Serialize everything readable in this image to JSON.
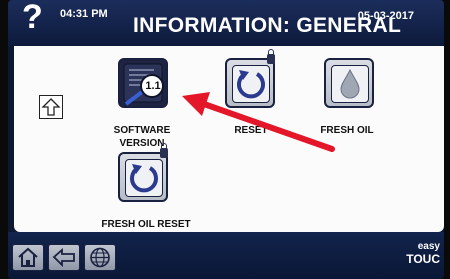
{
  "header": {
    "help_symbol": "?",
    "time": "04:31 PM",
    "title": "INFORMATION: GENERAL",
    "date": "05-03-2017"
  },
  "tiles": {
    "software_version": {
      "label_line1": "SOFTWARE",
      "label_line2": "VERSION",
      "badge": "1.1"
    },
    "reset": {
      "label": "RESET"
    },
    "fresh_oil": {
      "label": "FRESH OIL"
    },
    "fresh_oil_reset": {
      "label": "FRESH OIL RESET"
    }
  },
  "footer": {
    "brand_line1": "easy",
    "brand_line2": "TOUC"
  },
  "colors": {
    "top_bar": "#1b2d5b",
    "panel": "#fbfbfb",
    "annotation_arrow": "#e3162a"
  },
  "icons": [
    "help-icon",
    "up-arrow-icon",
    "home-icon",
    "back-arrow-icon",
    "globe-icon",
    "lock-icon",
    "reset-icon",
    "oil-drop-icon"
  ]
}
